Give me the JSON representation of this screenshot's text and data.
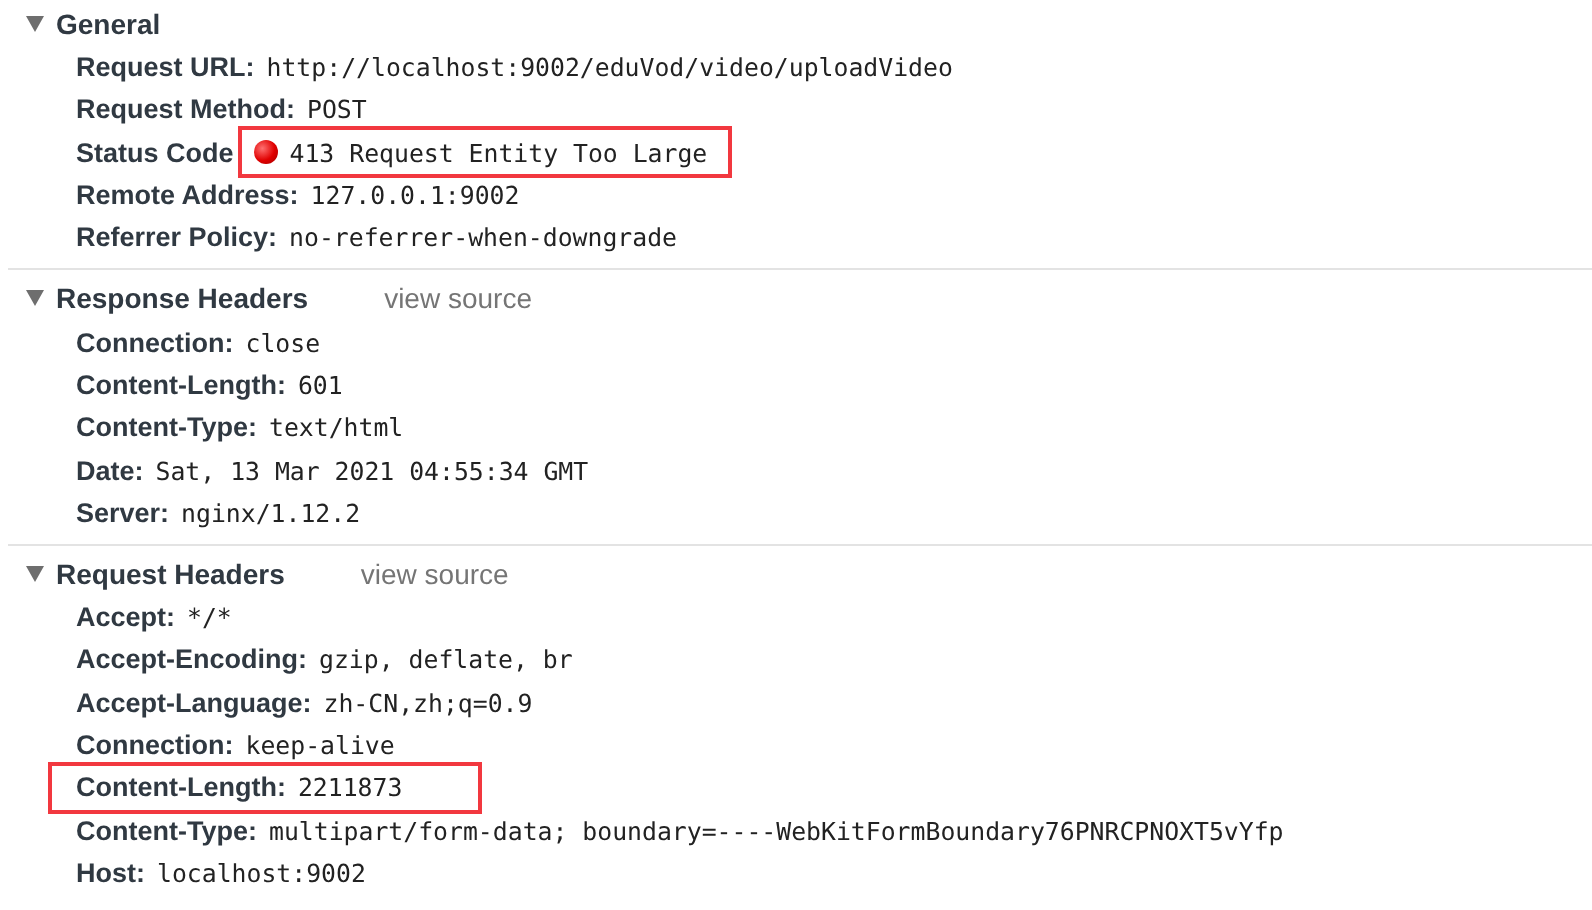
{
  "sections": [
    {
      "title": "General",
      "expanded": true,
      "rows": [
        {
          "kind": "plain",
          "label": "Request URL:",
          "value": "http://localhost:9002/eduVod/video/uploadVideo",
          "highlighted": false
        },
        {
          "kind": "plain",
          "label": "Request Method:",
          "value": "POST",
          "highlighted": false
        },
        {
          "kind": "status",
          "label": "Status Code",
          "value": "413 Request Entity Too Large",
          "highlighted": true
        },
        {
          "kind": "plain",
          "label": "Remote Address:",
          "value": "127.0.0.1:9002",
          "highlighted": false
        },
        {
          "kind": "plain",
          "label": "Referrer Policy:",
          "value": "no-referrer-when-downgrade",
          "highlighted": false
        }
      ]
    },
    {
      "title": "Response Headers",
      "link": "view source",
      "expanded": true,
      "rows": [
        {
          "kind": "plain",
          "label": "Connection:",
          "value": "close",
          "highlighted": false
        },
        {
          "kind": "plain",
          "label": "Content-Length:",
          "value": "601",
          "highlighted": false
        },
        {
          "kind": "plain",
          "label": "Content-Type:",
          "value": "text/html",
          "highlighted": false
        },
        {
          "kind": "plain",
          "label": "Date:",
          "value": "Sat, 13 Mar 2021 04:55:34 GMT",
          "highlighted": false
        },
        {
          "kind": "plain",
          "label": "Server:",
          "value": "nginx/1.12.2",
          "highlighted": false
        }
      ]
    },
    {
      "title": "Request Headers",
      "link": "view source",
      "expanded": true,
      "rows": [
        {
          "kind": "plain",
          "label": "Accept:",
          "value": "*/*",
          "highlighted": false
        },
        {
          "kind": "plain",
          "label": "Accept-Encoding:",
          "value": "gzip, deflate, br",
          "highlighted": false
        },
        {
          "kind": "plain",
          "label": "Accept-Language:",
          "value": "zh-CN,zh;q=0.9",
          "highlighted": false
        },
        {
          "kind": "plain",
          "label": "Connection:",
          "value": "keep-alive",
          "highlighted": false
        },
        {
          "kind": "plain",
          "label": "Content-Length:",
          "value": "2211873",
          "highlighted": true
        },
        {
          "kind": "plain",
          "label": "Content-Type:",
          "value": "multipart/form-data; boundary=----WebKitFormBoundary76PNRCPNOXT5vYfp",
          "highlighted": false
        },
        {
          "kind": "plain",
          "label": "Host:",
          "value": "localhost:9002",
          "highlighted": false
        }
      ]
    }
  ]
}
